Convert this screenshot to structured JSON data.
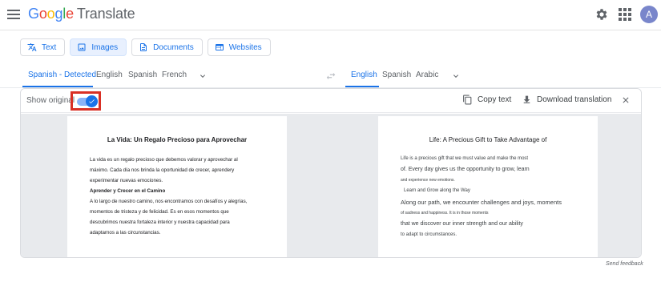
{
  "header": {
    "logo_text": "Google",
    "app_name": "Translate",
    "avatar_letter": "A"
  },
  "modes": [
    {
      "label": "Text",
      "icon": "translate-icon",
      "active": false
    },
    {
      "label": "Images",
      "icon": "image-icon",
      "active": true
    },
    {
      "label": "Documents",
      "icon": "document-icon",
      "active": false
    },
    {
      "label": "Websites",
      "icon": "web-icon",
      "active": false
    }
  ],
  "source_langs": [
    "Spanish - Detected",
    "English",
    "Spanish",
    "French"
  ],
  "target_langs": [
    "English",
    "Spanish",
    "Arabic"
  ],
  "toolbar": {
    "show_original": "Show original",
    "copy_text": "Copy text",
    "download": "Download translation"
  },
  "original": {
    "title": "La Vida: Un Regalo Precioso para Aprovechar",
    "lines": [
      "La vida es un regalo precioso que debemos valorar y aprovechar al",
      "máximo. Cada día nos brinda la oportunidad de crecer, aprendery",
      "experimentar nuevas emociones.",
      "Aprender y Crecer en el Camino",
      "A lo largo de nuestro camino, nos encontramos con desafíos y alegrías,",
      "momentos de tristeza y de felicidad. Es en esos momentos que",
      "descubrimos nuestra fortaleza interior y nuestra capacidad para",
      "adaptarnos a las circunstancias."
    ]
  },
  "translated": {
    "title": "Life: A Precious Gift to Take Advantage of",
    "lines": [
      "Life is a precious gift that we must value and make the most",
      "of. Every day gives us the opportunity to grow, learn",
      "and experience new emotions.",
      "Learn and Grow along the Way",
      "Along our path, we encounter challenges and joys, moments",
      "of sadness and happiness. It is in those moments",
      "that we discover our inner strength and our ability",
      "to adapt to circumstances."
    ]
  },
  "footer": {
    "feedback": "Send feedback"
  },
  "colors": {
    "accent": "#1a73e8",
    "highlight_box": "#d93025"
  }
}
